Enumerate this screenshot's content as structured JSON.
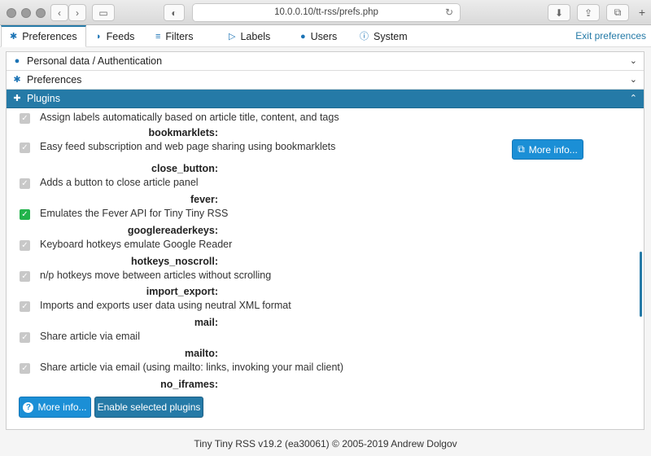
{
  "browser": {
    "url": "10.0.0.10/tt-rss/prefs.php"
  },
  "tabs": [
    {
      "label": "Preferences",
      "icon": "gear-icon",
      "active": true
    },
    {
      "label": "Feeds",
      "icon": "rss-icon"
    },
    {
      "label": "Filters",
      "icon": "filter-icon"
    },
    {
      "label": "Labels",
      "icon": "label-icon"
    },
    {
      "label": "Users",
      "icon": "user-icon"
    },
    {
      "label": "System",
      "icon": "info-icon"
    }
  ],
  "exit_label": "Exit preferences",
  "accordion": [
    {
      "label": "Personal data / Authentication",
      "icon": "user-icon"
    },
    {
      "label": "Preferences",
      "icon": "gear-icon"
    },
    {
      "label": "Plugins",
      "icon": "puzzle-icon",
      "open": true
    }
  ],
  "plugins": [
    {
      "name": "",
      "desc": "Assign labels automatically based on article title, content, and tags",
      "checked": false
    },
    {
      "name": "bookmarklets:",
      "desc": "Easy feed subscription and web page sharing using bookmarklets",
      "checked": false
    },
    {
      "name": "close_button:",
      "desc": "Adds a button to close article panel",
      "checked": false
    },
    {
      "name": "fever:",
      "desc": "Emulates the Fever API for Tiny Tiny RSS",
      "checked": true
    },
    {
      "name": "googlereaderkeys:",
      "desc": "Keyboard hotkeys emulate Google Reader",
      "checked": false
    },
    {
      "name": "hotkeys_noscroll:",
      "desc": "n/p hotkeys move between articles without scrolling",
      "checked": false
    },
    {
      "name": "import_export:",
      "desc": "Imports and exports user data using neutral XML format",
      "checked": false
    },
    {
      "name": "mail:",
      "desc": "Share article via email",
      "checked": false
    },
    {
      "name": "mailto:",
      "desc": "Share article via email (using mailto: links, invoking your mail client)",
      "checked": false
    },
    {
      "name": "no_iframes:",
      "desc": "",
      "checked": false
    }
  ],
  "row_more_info_label": "More info...",
  "buttons": {
    "more_info": "More info...",
    "enable": "Enable selected plugins"
  },
  "footer": "Tiny Tiny RSS v19.2 (ea30061) © 2005-2019 Andrew Dolgov"
}
